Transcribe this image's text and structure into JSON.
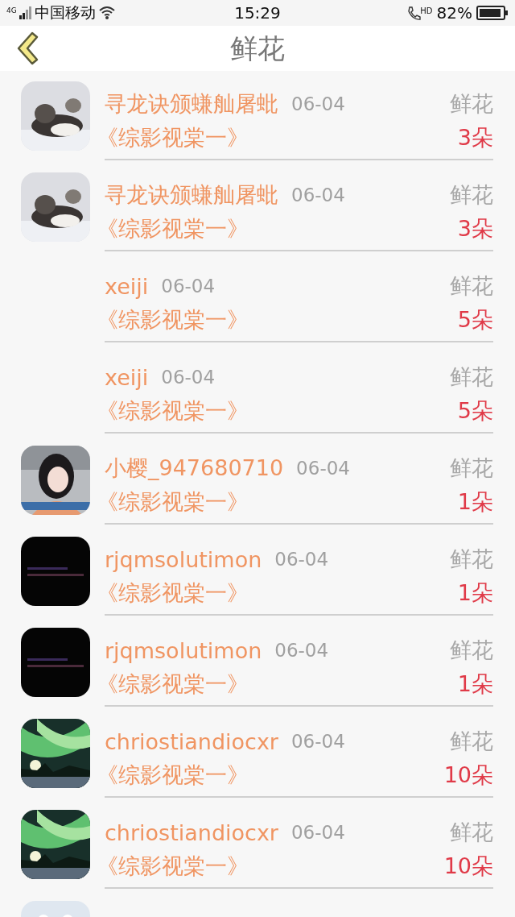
{
  "status_bar": {
    "network": "4G",
    "carrier": "中国移动",
    "time": "15:29",
    "call_badge": "HD",
    "battery": "82%"
  },
  "nav": {
    "title": "鲜花"
  },
  "rows": [
    {
      "avatar": {
        "kind": "picture"
      },
      "name": "寻龙诀颁螊舢屠蚍",
      "date": "06-04",
      "gift": "鲜花",
      "work": "《综影视棠一》",
      "count": "3朵"
    },
    {
      "avatar": {
        "kind": "picture"
      },
      "name": "寻龙诀颁螊舢屠蚍",
      "date": "06-04",
      "gift": "鲜花",
      "work": "《综影视棠一》",
      "count": "3朵"
    },
    {
      "name": "xeiji",
      "date": "06-04",
      "gift": "鲜花",
      "work": "《综影视棠一》",
      "count": "5朵"
    },
    {
      "name": "xeiji",
      "date": "06-04",
      "gift": "鲜花",
      "work": "《综影视棠一》",
      "count": "5朵"
    },
    {
      "avatar": {
        "kind": "picture"
      },
      "name": "小樱_947680710",
      "date": "06-04",
      "gift": "鲜花",
      "work": "《综影视棠一》",
      "count": "1朵"
    },
    {
      "avatar": {
        "kind": "picture"
      },
      "name": "rjqmsolutimon",
      "date": "06-04",
      "gift": "鲜花",
      "work": "《综影视棠一》",
      "count": "1朵"
    },
    {
      "avatar": {
        "kind": "picture"
      },
      "name": "rjqmsolutimon",
      "date": "06-04",
      "gift": "鲜花",
      "work": "《综影视棠一》",
      "count": "1朵"
    },
    {
      "avatar": {
        "kind": "picture"
      },
      "name": "chriostiandiocxr",
      "date": "06-04",
      "gift": "鲜花",
      "work": "《综影视棠一》",
      "count": "10朵"
    },
    {
      "avatar": {
        "kind": "picture"
      },
      "name": "chriostiandiocxr",
      "date": "06-04",
      "gift": "鲜花",
      "work": "《综影视棠一》",
      "count": "10朵"
    },
    {
      "avatar": {
        "kind": "picture"
      }
    }
  ]
}
